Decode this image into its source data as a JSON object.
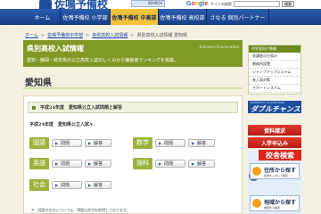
{
  "header": {
    "logo_text": "佐鳴予備校",
    "search_button": "SEARCH",
    "google": [
      "G",
      "o",
      "o",
      "g",
      "l",
      "e"
    ],
    "site_search_label": "サイト内検索",
    "search_go": "検索"
  },
  "nav": {
    "items": [
      {
        "label": "ホーム"
      },
      {
        "label": "佐鳴予備校 小学部"
      },
      {
        "label": "佐鳴予備校 中高部"
      },
      {
        "label": "佐鳴予備校 高校部"
      },
      {
        "label": "さなる 個別パートナー"
      }
    ],
    "active_index": 2
  },
  "breadcrumb": [
    "ホーム",
    "佐鳴予備校中学部",
    "各県高校入試情報",
    "県別高校入試情報 愛知県"
  ],
  "banner": {
    "title": "県別高校入試情報",
    "subtitle_en": "Entrance Examination",
    "description": "愛知・静岡・岐阜県の公立高校入試のしくみから偏差値ランキングを掲載。"
  },
  "prefecture": "愛知県",
  "exam_box": {
    "heading": "平成24年度　愛知県公立入試問題と解答",
    "exam_title": "平成24年度　愛知県公立入試A",
    "subjects": [
      {
        "label": "国語",
        "problem": "問題",
        "answer": "解答"
      },
      {
        "label": "数学",
        "problem": "問題",
        "answer": "解答"
      },
      {
        "label": "英語",
        "problem": "問題",
        "answer": "解答"
      },
      {
        "label": "理科",
        "problem": "問題",
        "answer": "解答"
      },
      {
        "label": "社会",
        "problem": "問題",
        "answer": "解答"
      }
    ],
    "note": "※　国語の本文については、掲載の許可を取得しております。"
  },
  "sidebar": {
    "info_header": "中学部向け情報",
    "info_items": [
      "各講座の仕組み",
      "教務所設置",
      "ジャンプアップシステム",
      "各入試対策",
      "サポートシステム"
    ],
    "dm_small": "UNIVERSITY TO PROGRAM",
    "dm_big": "ダブルチャンス",
    "request_button": "資料請求",
    "enroll_button": "入学申込み",
    "school_search": {
      "title": "校舎検索",
      "by_address_main": "住所から探す",
      "by_address_sub": "住所を入力して検索",
      "by_map_main": "地域から探す",
      "by_map_sub": "地図から検索"
    }
  }
}
